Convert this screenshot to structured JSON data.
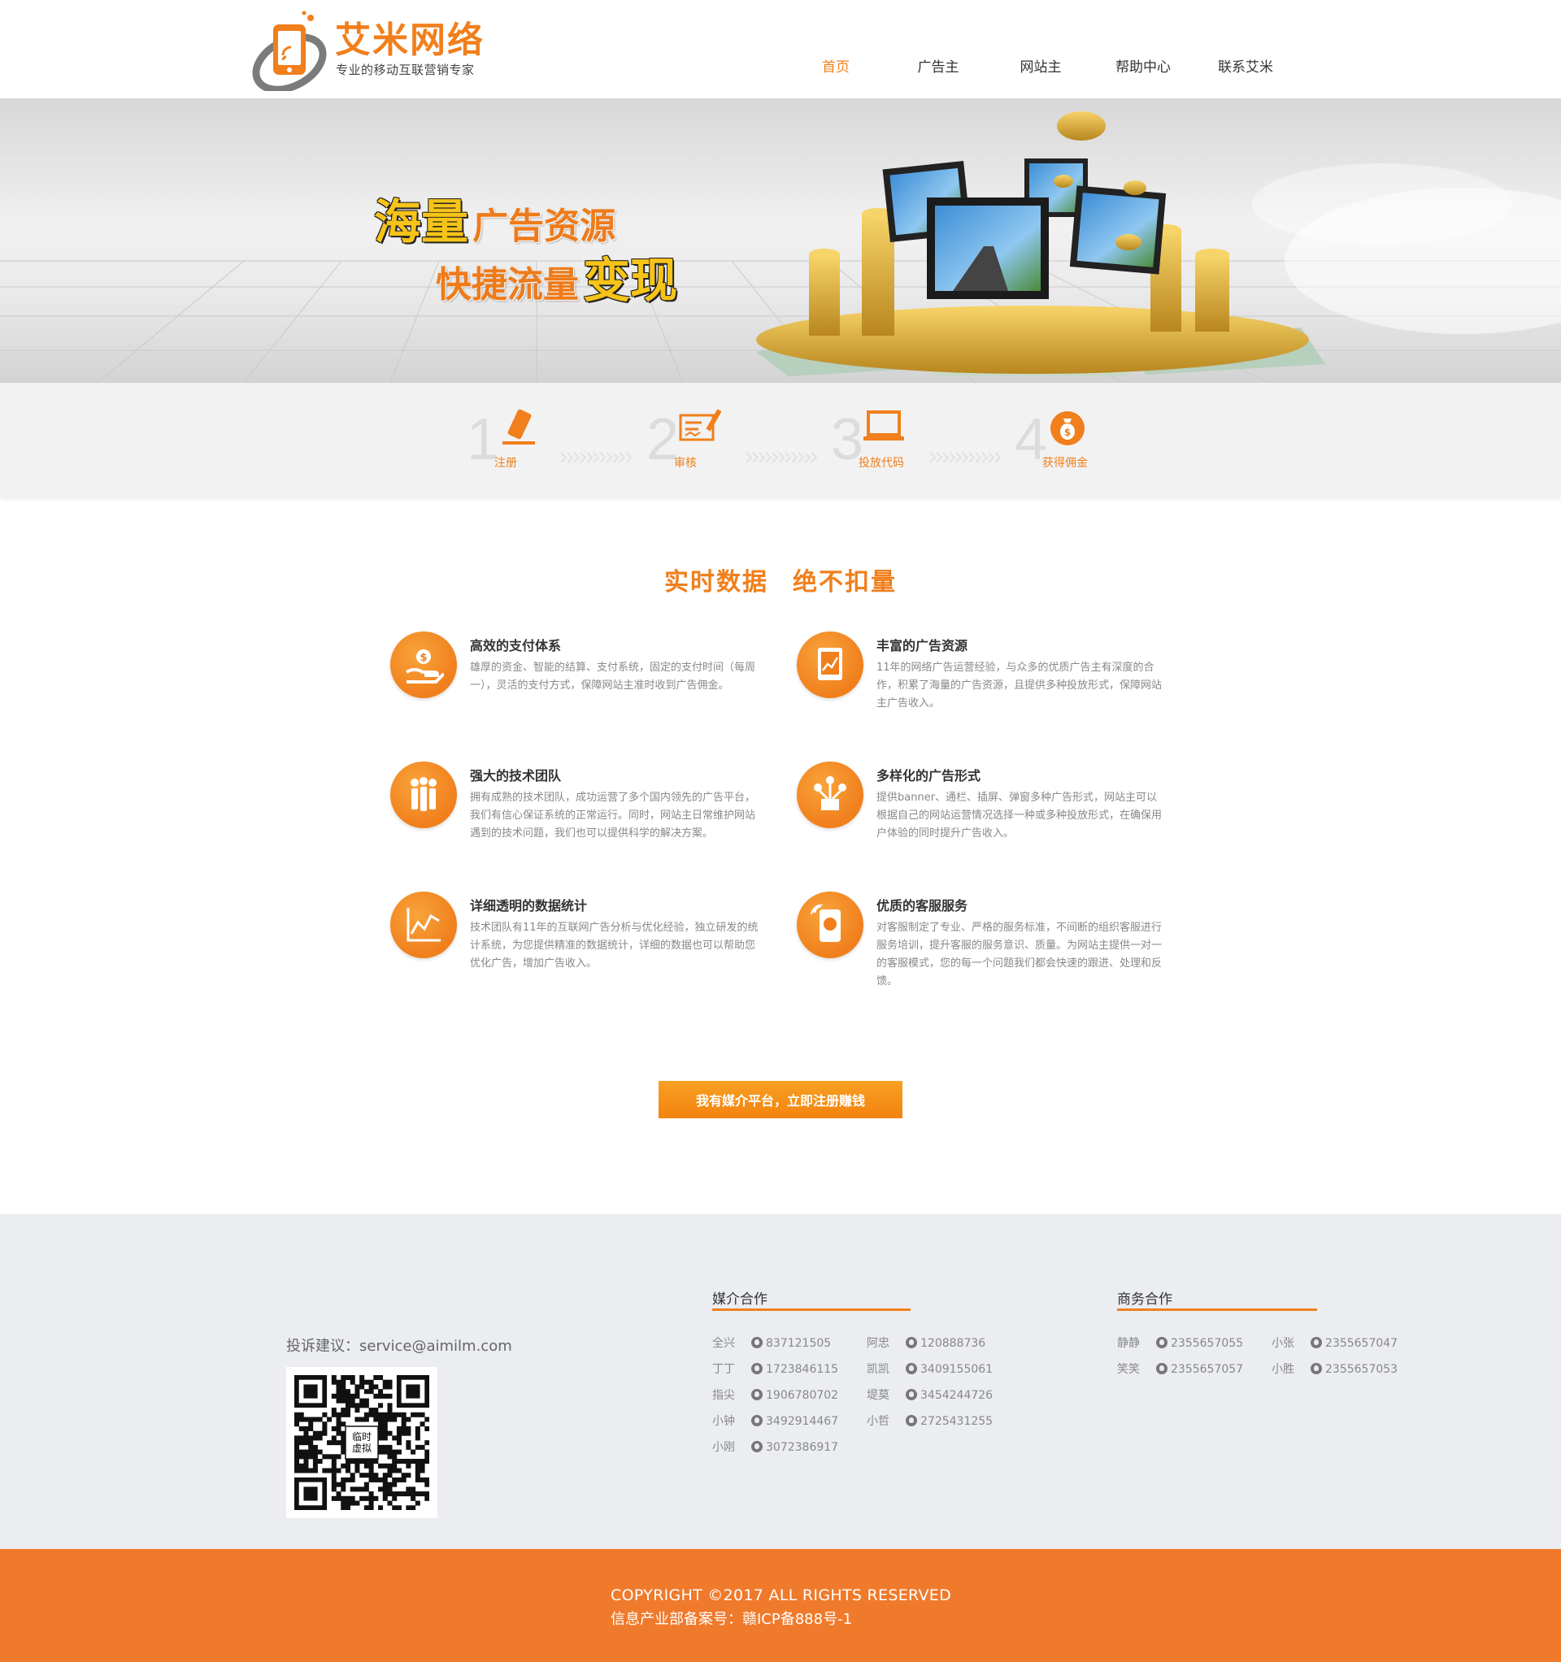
{
  "brand": {
    "name": "艾米网络",
    "slogan": "专业的移动互联营销专家",
    "primary_color": "#f07f1c",
    "footer_color": "#f07a2b"
  },
  "nav": {
    "items": [
      {
        "label": "首页",
        "active": true
      },
      {
        "label": "广告主",
        "active": false
      },
      {
        "label": "网站主",
        "active": false
      },
      {
        "label": "帮助中心",
        "active": false
      },
      {
        "label": "联系艾米",
        "active": false
      }
    ]
  },
  "banner": {
    "line1_big": "海量",
    "line1_rest": "广告资源",
    "line2_rest": "快捷流量",
    "line2_big": "变现"
  },
  "steps": [
    {
      "number": "1",
      "label": "注册",
      "icon": "pencil-icon"
    },
    {
      "number": "2",
      "label": "审核",
      "icon": "review-icon"
    },
    {
      "number": "3",
      "label": "投放代码",
      "icon": "laptop-icon"
    },
    {
      "number": "4",
      "label": "获得佣金",
      "icon": "money-bag-icon"
    }
  ],
  "features": {
    "title_a": "实时数据",
    "title_b": "绝不扣量",
    "items": [
      {
        "title": "高效的支付体系",
        "desc": "雄厚的资金、智能的结算、支付系统，固定的支付时间（每周一），灵活的支付方式，保障网站主准时收到广告佣金。",
        "icon": "payment-hand-icon"
      },
      {
        "title": "丰富的广告资源",
        "desc": "11年的网络广告运营经验，与众多的优质广告主有深度的合作，积累了海量的广告资源，且提供多种投放形式，保障网站主广告收入。",
        "icon": "tablet-chart-icon"
      },
      {
        "title": "强大的技术团队",
        "desc": "拥有成熟的技术团队，成功运营了多个国内领先的广告平台，我们有信心保证系统的正常运行。同时，网站主日常维护网站遇到的技术问题，我们也可以提供科学的解决方案。",
        "icon": "team-icon"
      },
      {
        "title": "多样化的广告形式",
        "desc": "提供banner、通栏、插屏、弹窗多种广告形式，网站主可以根据自己的网站运营情况选择一种或多种投放形式，在确保用户体验的同时提升广告收入。",
        "icon": "ad-forms-icon"
      },
      {
        "title": "详细透明的数据统计",
        "desc": "技术团队有11年的互联网广告分析与优化经验，独立研发的统计系统，为您提供精准的数据统计，详细的数据也可以帮助您优化广告，增加广告收入。",
        "icon": "line-chart-icon"
      },
      {
        "title": "优质的客服服务",
        "desc": "对客服制定了专业、严格的服务标准，不间断的组织客服进行服务培训，提升客服的服务意识、质量。为网站主提供一对一的客服模式，您的每一个问题我们都会快速的跟进、处理和反馈。",
        "icon": "customer-service-icon"
      }
    ],
    "cta_label": "我有媒介平台，立即注册赚钱"
  },
  "footer": {
    "complaint": "投诉建议：service@aimilm.com",
    "qr_caption": "临时虚拟",
    "media_title": "媒介合作",
    "media_contacts": [
      {
        "name": "全兴",
        "qq": "837121505"
      },
      {
        "name": "阿忠",
        "qq": "120888736"
      },
      {
        "name": "丁丁",
        "qq": "1723846115"
      },
      {
        "name": "凯凯",
        "qq": "3409155061"
      },
      {
        "name": "指尖",
        "qq": "1906780702"
      },
      {
        "name": "堤莫",
        "qq": "3454244726"
      },
      {
        "name": "小钟",
        "qq": "3492914467"
      },
      {
        "name": "小哲",
        "qq": "2725431255"
      },
      {
        "name": "小刚",
        "qq": "3072386917"
      }
    ],
    "business_title": "商务合作",
    "business_contacts": [
      {
        "name": "静静",
        "qq": "2355657055"
      },
      {
        "name": "小张",
        "qq": "2355657047"
      },
      {
        "name": "笑笑",
        "qq": "2355657057"
      },
      {
        "name": "小胜",
        "qq": "2355657053"
      }
    ]
  },
  "copyright": {
    "line1": "COPYRIGHT ©2017 ALL RIGHTS RESERVED",
    "line2": "信息产业部备案号：赣ICP备888号-1"
  }
}
